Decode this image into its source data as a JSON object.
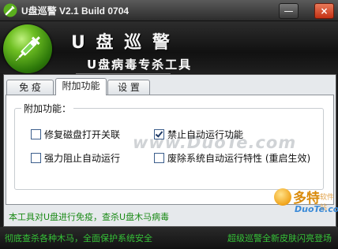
{
  "window": {
    "title": "U盘巡警 V2.1 Build 0704",
    "minimize_symbol": "—",
    "close_symbol": "×"
  },
  "header": {
    "brand_name": "U 盘 巡 警",
    "subtitle": "U盘病毒专杀工具"
  },
  "tabs": [
    {
      "label": "免 疫",
      "active": false
    },
    {
      "label": "附加功能",
      "active": true
    },
    {
      "label": "设 置",
      "active": false
    }
  ],
  "panel": {
    "group_title": "附加功能：",
    "options": [
      {
        "label": "修复磁盘打开关联",
        "checked": false
      },
      {
        "label": "禁止自动运行功能",
        "checked": true
      },
      {
        "label": "强力阻止自动运行",
        "checked": false
      },
      {
        "label": "废除系统自动运行特性 (重启生效)",
        "checked": false
      }
    ]
  },
  "notice": "本工具对U盘进行免疫，查杀U盘木马病毒",
  "watermark": {
    "text": "www.DuoTe.com",
    "logo_name": "多特",
    "logo_sub": "软件站",
    "logo_domain": "DuoTe.com"
  },
  "status": {
    "left": "彻底查杀各种木马，全面保护系统安全",
    "right": "超级巡警全新皮肤闪亮登场"
  },
  "colors": {
    "status_text": "#36c238",
    "notice_text": "#1a8a16",
    "close_button": "#c43214"
  },
  "icons": {
    "app": "syringe-icon",
    "logo": "syringe-icon",
    "check": "checkmark-icon"
  }
}
